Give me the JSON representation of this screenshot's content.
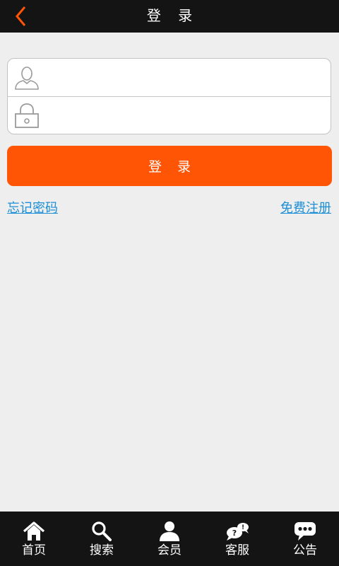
{
  "header": {
    "title": "登 录",
    "back_icon": "chevron-left-icon",
    "accent_color": "#ff5505"
  },
  "form": {
    "username": {
      "icon": "user-icon",
      "value": "",
      "placeholder": ""
    },
    "password": {
      "icon": "lock-icon",
      "value": "",
      "placeholder": ""
    }
  },
  "login_button": {
    "label": "登 录",
    "color": "#ff5505"
  },
  "links": {
    "forgot_password": "忘记密码",
    "register": "免费注册",
    "color": "#1c8fd6"
  },
  "tabbar": {
    "items": [
      {
        "label": "首页",
        "icon": "home-icon"
      },
      {
        "label": "搜索",
        "icon": "search-icon"
      },
      {
        "label": "会员",
        "icon": "member-icon"
      },
      {
        "label": "客服",
        "icon": "customer-service-icon"
      },
      {
        "label": "公告",
        "icon": "announcement-icon"
      }
    ]
  }
}
